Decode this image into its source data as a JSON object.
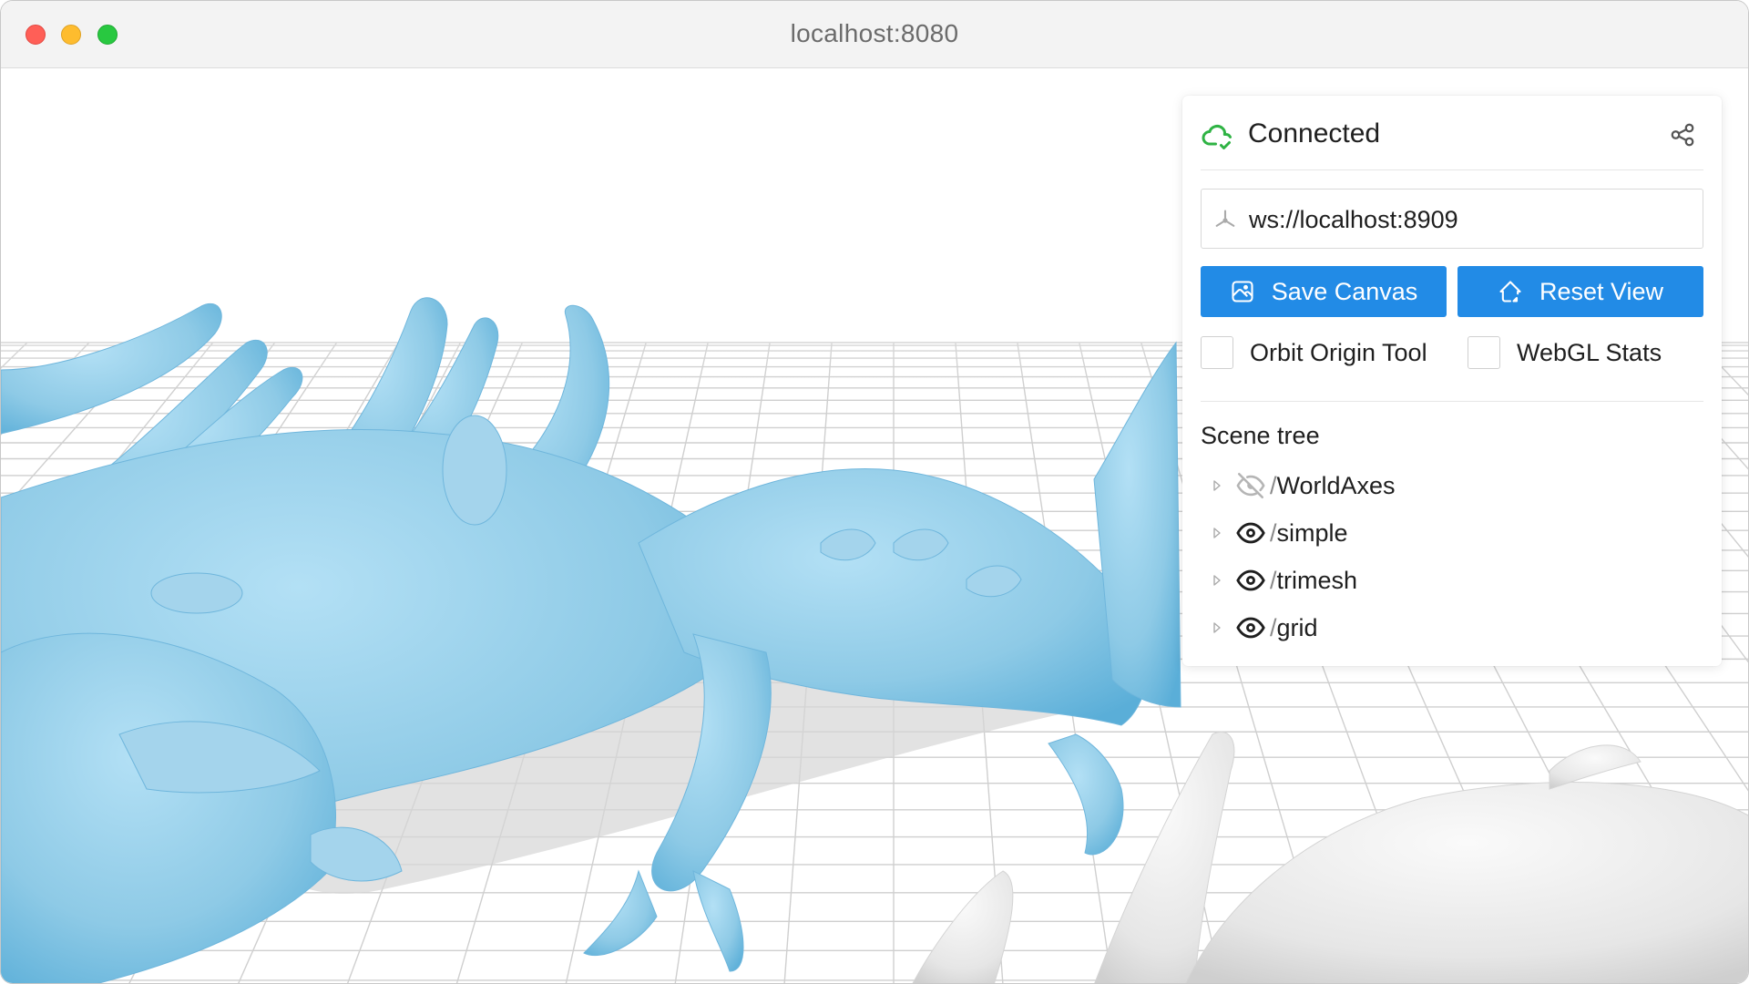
{
  "window": {
    "title": "localhost:8080"
  },
  "panel": {
    "status": "Connected",
    "server_url": "ws://localhost:8909",
    "buttons": {
      "save_canvas": "Save Canvas",
      "reset_view": "Reset View"
    },
    "checkboxes": {
      "orbit_origin_tool": {
        "label": "Orbit Origin Tool",
        "checked": false
      },
      "webgl_stats": {
        "label": "WebGL Stats",
        "checked": false
      }
    },
    "scene_tree": {
      "title": "Scene tree",
      "nodes": [
        {
          "name": "WorldAxes",
          "visible": false
        },
        {
          "name": "simple",
          "visible": true
        },
        {
          "name": "trimesh",
          "visible": true
        },
        {
          "name": "grid",
          "visible": true
        }
      ]
    }
  },
  "colors": {
    "accent": "#228be6",
    "connected": "#2fb344",
    "mesh_blue": "#8ecae6",
    "mesh_white": "#eeeeee"
  },
  "icons": {
    "status": "cloud-check-icon",
    "share": "share-icon",
    "server": "server-icon",
    "save": "photo-icon",
    "reset": "home-icon",
    "visible": "eye-icon",
    "hidden": "eye-off-icon",
    "expand": "chevron-right-icon"
  }
}
